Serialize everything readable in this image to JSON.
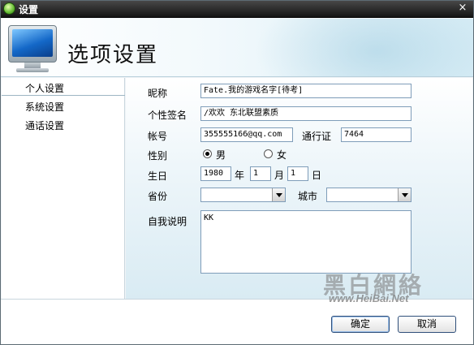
{
  "window": {
    "title": "设置",
    "close_glyph": "×"
  },
  "header": {
    "title": "选项设置"
  },
  "sidebar": {
    "items": [
      {
        "label": "个人设置"
      },
      {
        "label": "系统设置"
      },
      {
        "label": "通话设置"
      }
    ]
  },
  "form": {
    "nickname": {
      "label": "昵称",
      "value": "Fate.我的游戏名字[待考]"
    },
    "signature": {
      "label": "个性签名",
      "value": "/欢欢 东北联盟素质"
    },
    "account": {
      "label": "帐号",
      "value": "355555166@qq.com"
    },
    "pass": {
      "label": "通行证",
      "value": "7464"
    },
    "gender": {
      "label": "性别",
      "male": "男",
      "female": "女"
    },
    "birthday": {
      "label": "生日",
      "year": "1980",
      "year_unit": "年",
      "month": "1",
      "month_unit": "月",
      "day": "1",
      "day_unit": "日"
    },
    "province": {
      "label": "省份",
      "value": ""
    },
    "city": {
      "label": "城市",
      "value": ""
    },
    "bio": {
      "label": "自我说明",
      "value": "KK"
    }
  },
  "watermark": {
    "logo": "黑白網絡",
    "url": "www.HeiBai.Net"
  },
  "buttons": {
    "ok": "确定",
    "cancel": "取消"
  }
}
